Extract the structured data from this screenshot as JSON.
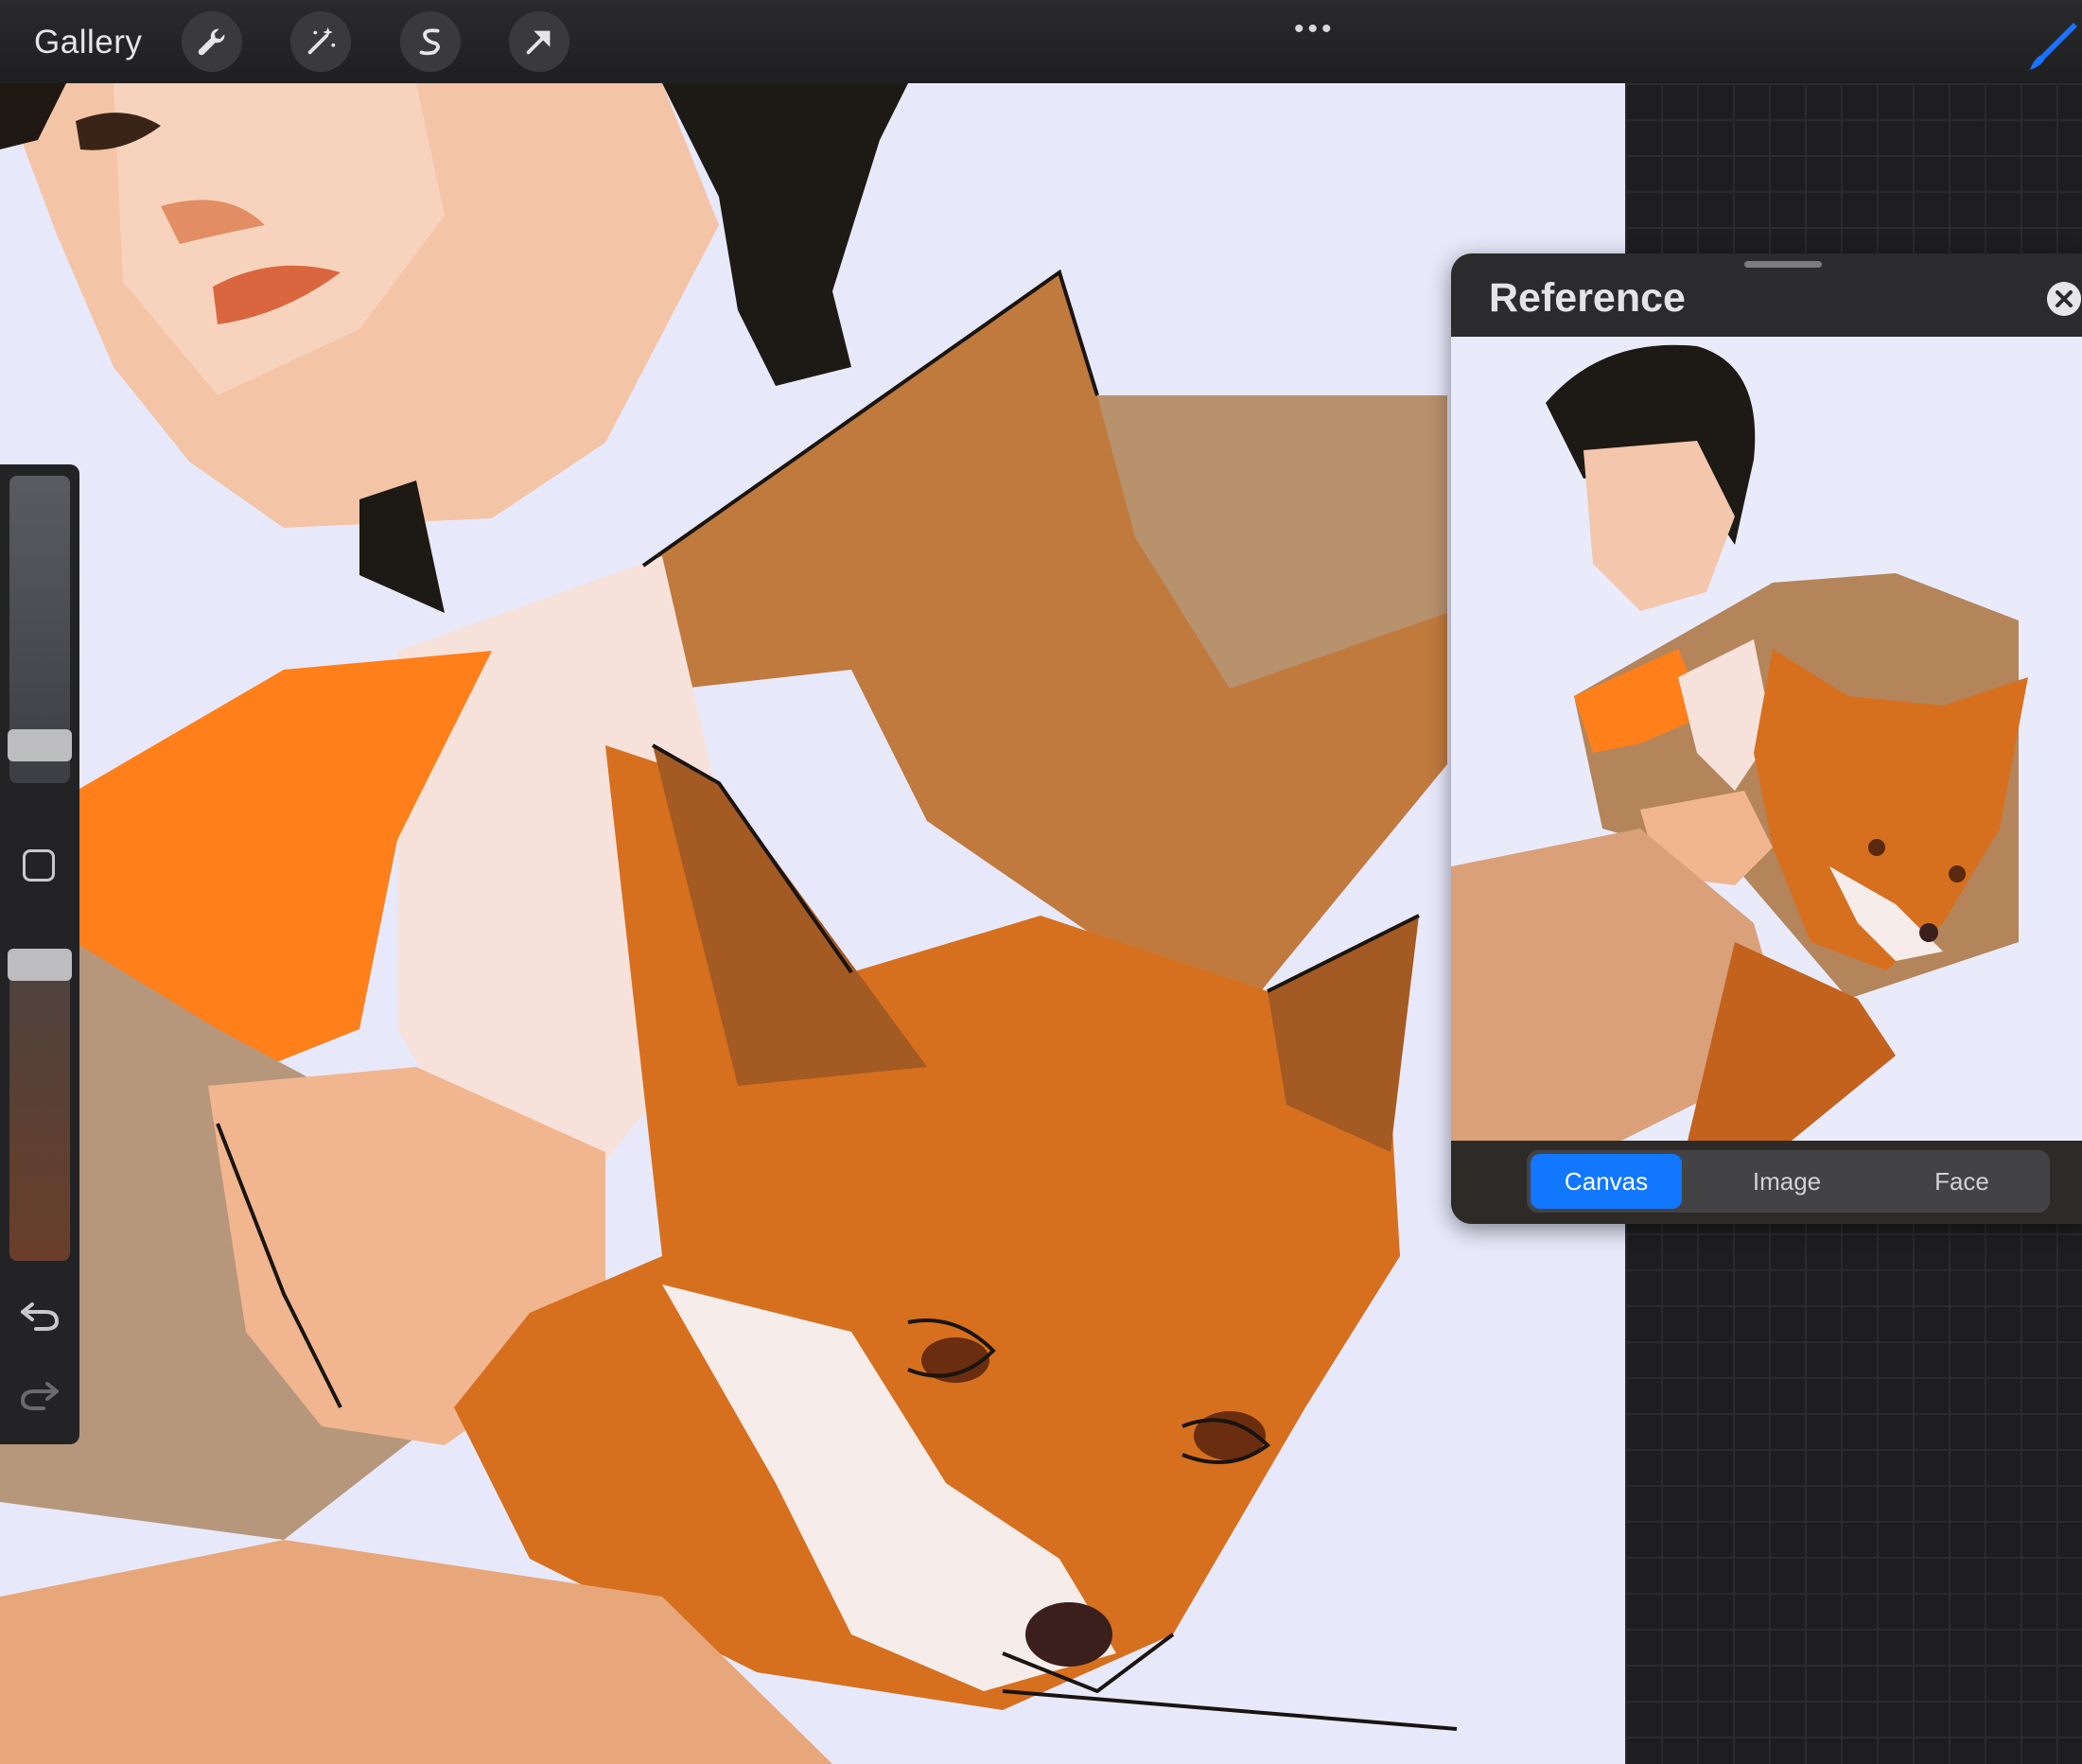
{
  "toolbar": {
    "gallery_label": "Gallery",
    "tools": [
      "wrench-icon",
      "magic-wand-icon",
      "selection-icon",
      "transform-arrow-icon"
    ],
    "more_label": "•••",
    "brush_color": "#1a73ff"
  },
  "reference": {
    "title": "Reference",
    "tabs": [
      {
        "label": "Canvas",
        "active": true
      },
      {
        "label": "Image",
        "active": false
      },
      {
        "label": "Face",
        "active": false
      }
    ],
    "accent": "#1177ff"
  },
  "sidebar": {
    "brush_size_level": 0.25,
    "opacity_level": 0.95
  },
  "colors": {
    "canvas_bg": "#e7e9fb",
    "jacket_orange": "#ff7f1a",
    "fox_orange": "#d6701f"
  }
}
